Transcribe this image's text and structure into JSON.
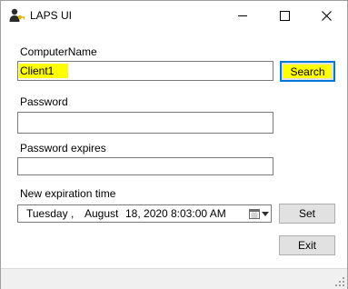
{
  "window": {
    "title": "LAPS UI"
  },
  "computer": {
    "label": "ComputerName",
    "value": "Client1",
    "search_label": "Search"
  },
  "password": {
    "label": "Password",
    "value": ""
  },
  "expires": {
    "label": "Password expires",
    "value": ""
  },
  "expiration": {
    "label": "New expiration time",
    "weekday": "Tuesday",
    "sep": ",",
    "month": "August",
    "day_year": "18, 2020",
    "time": "8:03:00 AM",
    "set_label": "Set"
  },
  "exit_label": "Exit",
  "colors": {
    "highlight": "#ffff00",
    "focus_border": "#0078d7"
  },
  "icons": [
    "laps-user-key-icon",
    "minimize-icon",
    "maximize-icon",
    "close-icon",
    "calendar-icon",
    "dropdown-arrow-icon",
    "resize-grip-icon"
  ]
}
